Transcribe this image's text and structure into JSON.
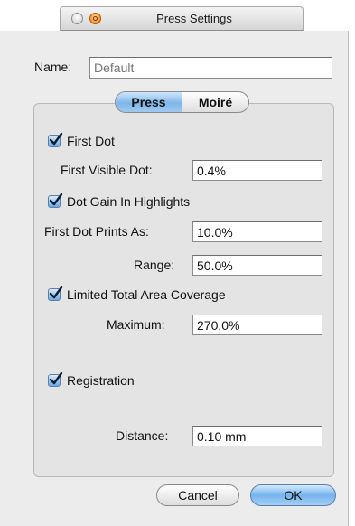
{
  "window": {
    "title": "Press Settings"
  },
  "name_field": {
    "label": "Name:",
    "placeholder": "Default",
    "value": ""
  },
  "tabs": [
    {
      "label": "Press",
      "selected": true
    },
    {
      "label": "Moiré",
      "selected": false
    }
  ],
  "press": {
    "first_dot": {
      "label": "First Dot",
      "checked": true
    },
    "first_visible_dot": {
      "label": "First Visible Dot:",
      "value": "0.4%"
    },
    "dot_gain": {
      "label": "Dot Gain In Highlights",
      "checked": true
    },
    "first_dot_prints_as": {
      "label": "First Dot Prints As:",
      "value": "10.0%"
    },
    "range": {
      "label": "Range:",
      "value": "50.0%"
    },
    "limited_tac": {
      "label": "Limited Total Area Coverage",
      "checked": true
    },
    "maximum": {
      "label": "Maximum:",
      "value": "270.0%"
    },
    "registration": {
      "label": "Registration",
      "checked": true
    },
    "distance": {
      "label": "Distance:",
      "value": "0.10 mm"
    }
  },
  "buttons": {
    "cancel": "Cancel",
    "ok": "OK"
  },
  "colors": {
    "accent": "#7fb6ea",
    "window_bg": "#ececec"
  }
}
